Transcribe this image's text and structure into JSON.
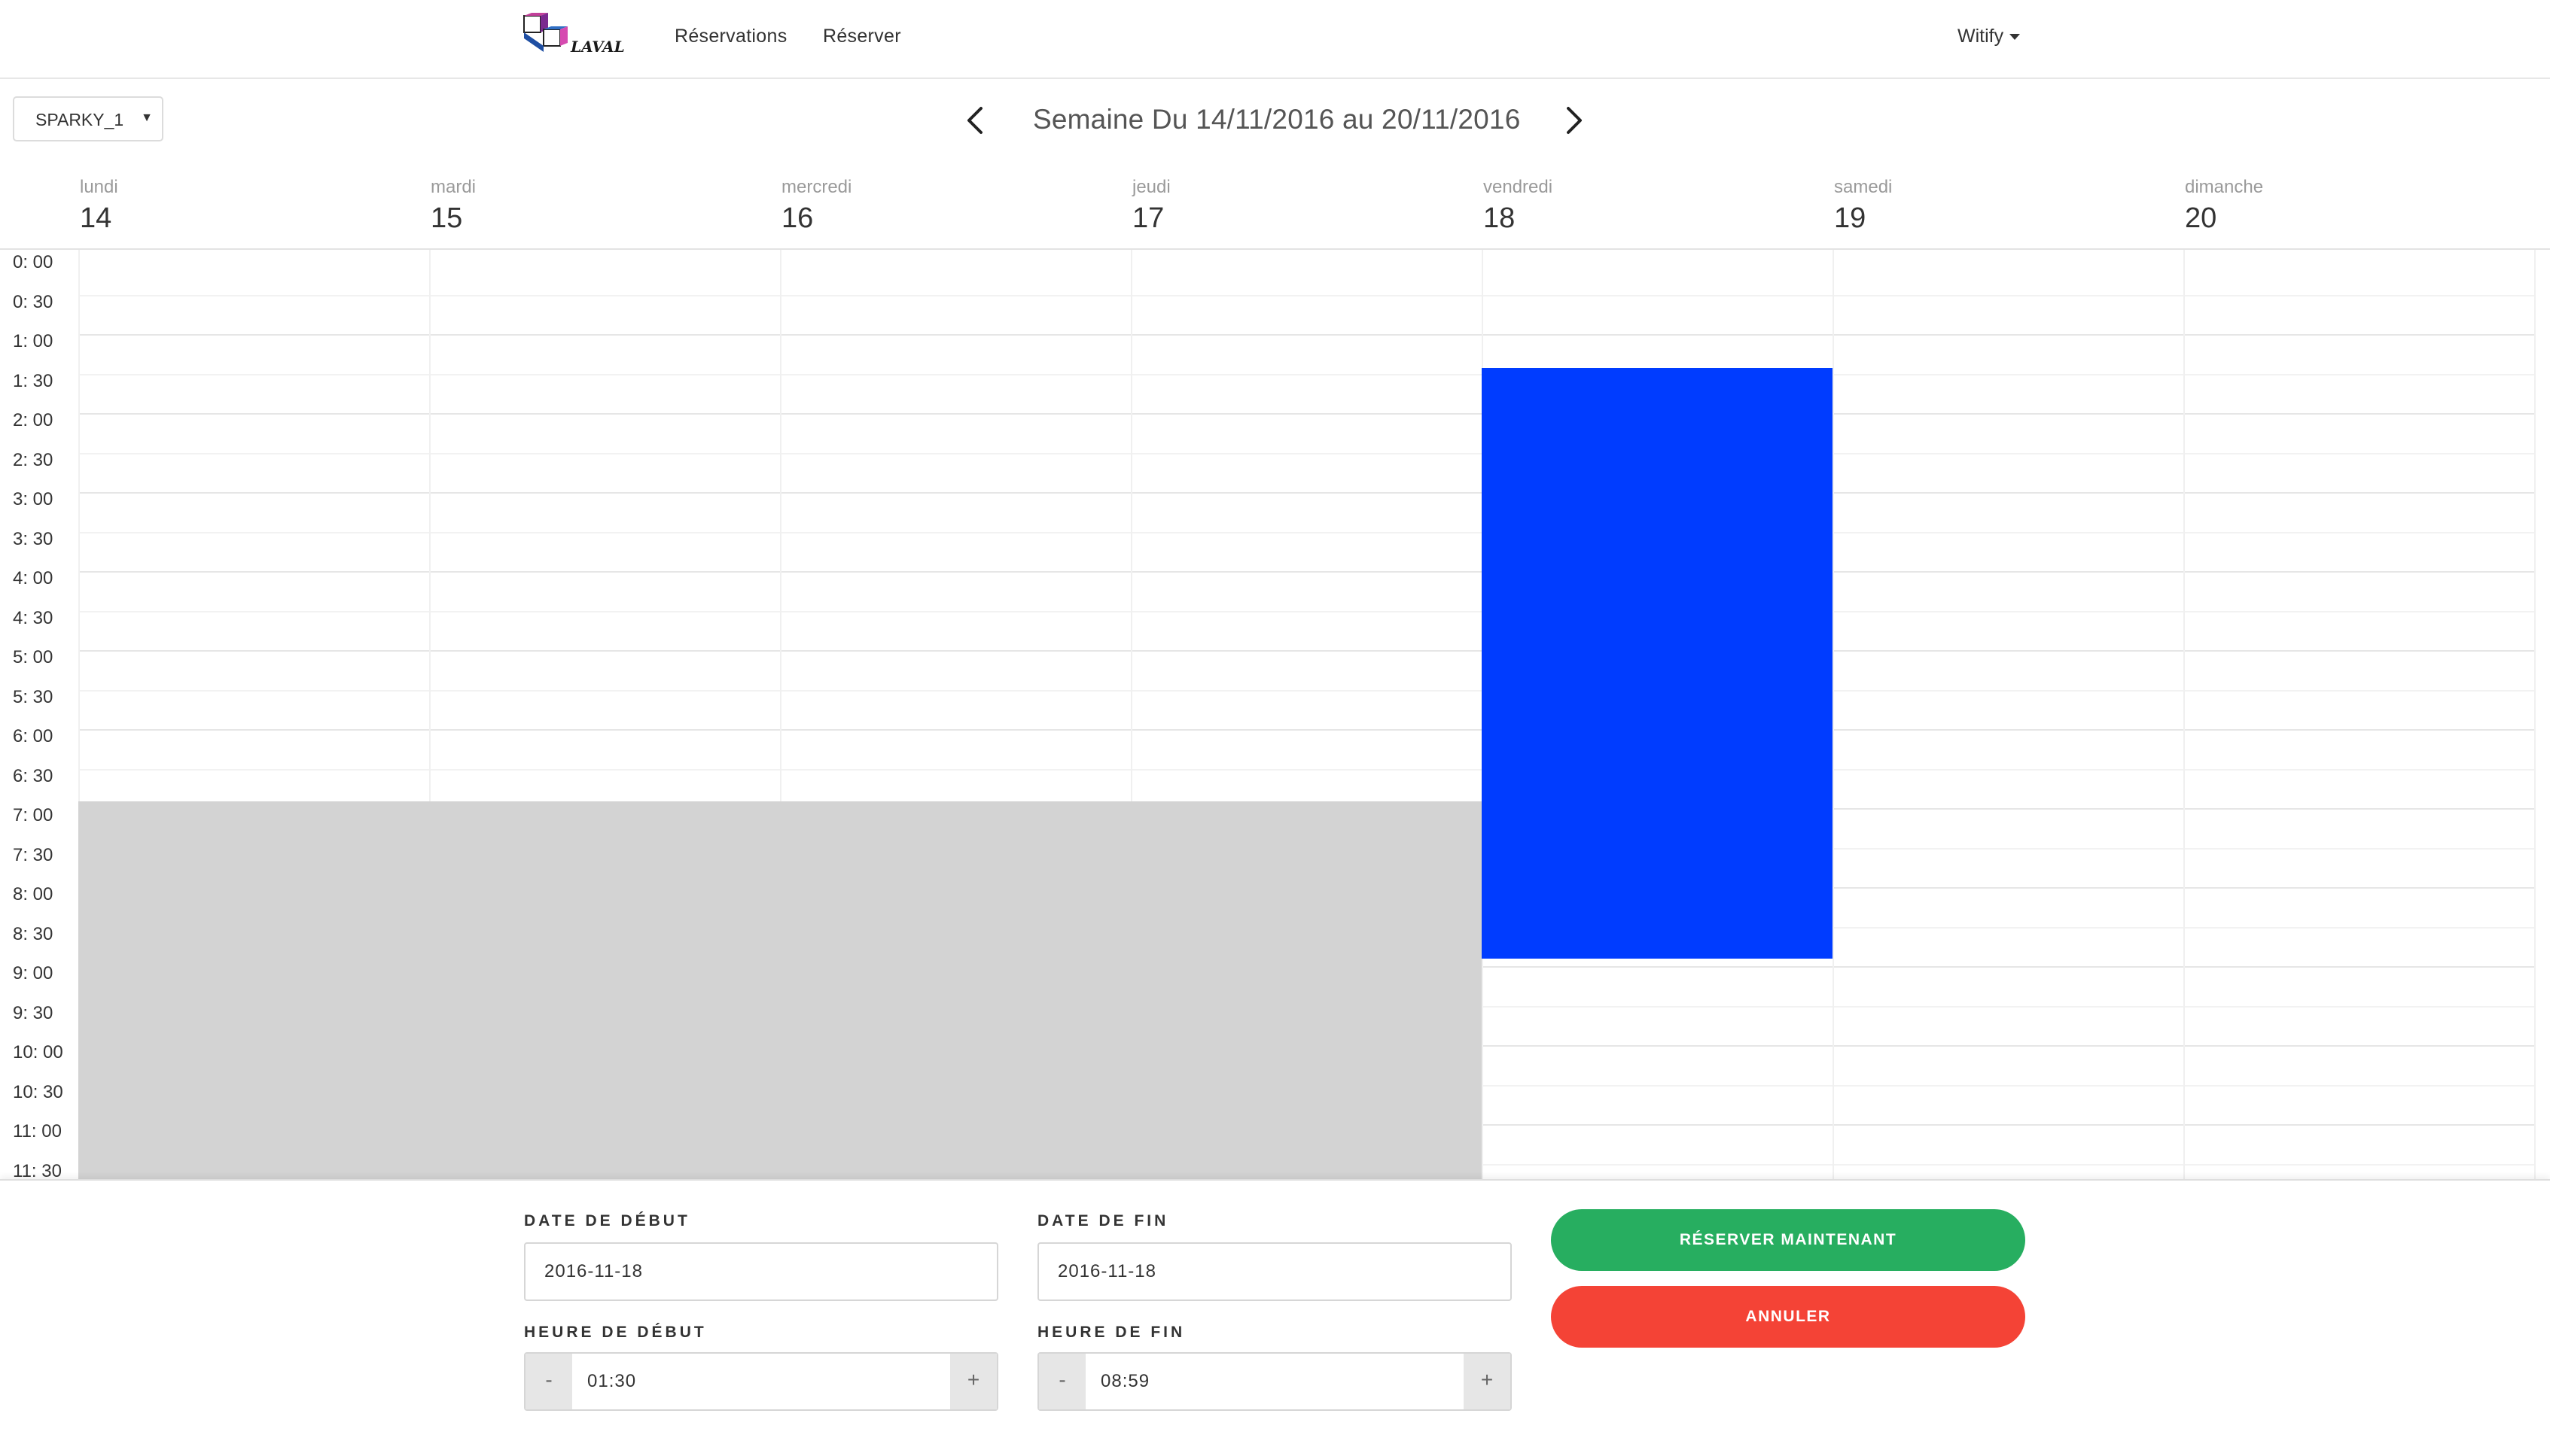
{
  "navbar": {
    "logo_text": "LAVAL",
    "links": [
      "Réservations",
      "Réserver"
    ],
    "user": "Witify"
  },
  "toolbar": {
    "device": "SPARKY_1",
    "week_title": "Semaine Du 14/11/2016 au 20/11/2016"
  },
  "days": [
    {
      "name": "lundi",
      "num": "14"
    },
    {
      "name": "mardi",
      "num": "15"
    },
    {
      "name": "mercredi",
      "num": "16"
    },
    {
      "name": "jeudi",
      "num": "17"
    },
    {
      "name": "vendredi",
      "num": "18"
    },
    {
      "name": "samedi",
      "num": "19"
    },
    {
      "name": "dimanche",
      "num": "20"
    }
  ],
  "time_labels": [
    "0: 00",
    "0: 30",
    "1: 00",
    "1: 30",
    "2: 00",
    "2: 30",
    "3: 00",
    "3: 30",
    "4: 00",
    "4: 30",
    "5: 00",
    "5: 30",
    "6: 00",
    "6: 30",
    "7: 00",
    "7: 30",
    "8: 00",
    "8: 30",
    "9: 00",
    "9: 30",
    "10: 00",
    "10: 30",
    "11: 00",
    "11: 30"
  ],
  "unavailable": {
    "from_day": "lundi",
    "to_day": "jeudi",
    "start": "7:00"
  },
  "selection": {
    "day": "vendredi",
    "start": "1:30",
    "end": "9:00",
    "color": "#003cff"
  },
  "form": {
    "start_date_label": "DATE DE DÉBUT",
    "start_date": "2016-11-18",
    "end_date_label": "DATE DE FIN",
    "end_date": "2016-11-18",
    "start_time_label": "HEURE DE DÉBUT",
    "start_time": "01:30",
    "end_time_label": "HEURE DE FIN",
    "end_time": "08:59",
    "minus": "-",
    "plus": "+",
    "book_label": "RÉSERVER MAINTENANT",
    "cancel_label": "ANNULER"
  },
  "colors": {
    "book": "#27ae60",
    "cancel": "#f44336",
    "unavailable": "#d3d3d3"
  }
}
